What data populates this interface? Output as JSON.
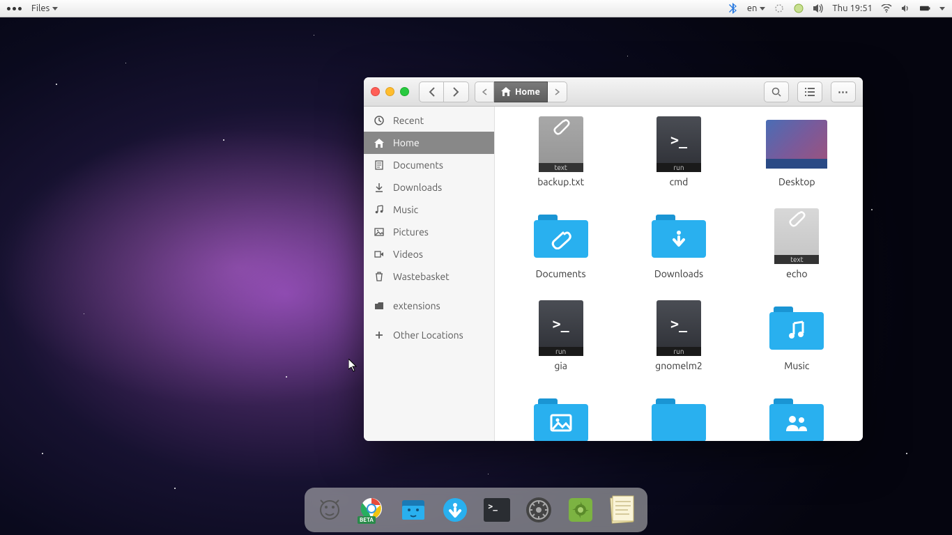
{
  "panel": {
    "app_name": "Files",
    "lang": "en",
    "clock": "Thu 19:51"
  },
  "window": {
    "path_label": "Home"
  },
  "sidebar": {
    "items": [
      {
        "label": "Recent",
        "icon": "clock"
      },
      {
        "label": "Home",
        "icon": "home",
        "active": true
      },
      {
        "label": "Documents",
        "icon": "doc"
      },
      {
        "label": "Downloads",
        "icon": "down"
      },
      {
        "label": "Music",
        "icon": "music"
      },
      {
        "label": "Pictures",
        "icon": "pic"
      },
      {
        "label": "Videos",
        "icon": "vid"
      },
      {
        "label": "Wastebasket",
        "icon": "trash"
      }
    ],
    "extra": {
      "label": "extensions"
    },
    "other": {
      "label": "Other Locations"
    }
  },
  "files": [
    {
      "label": "backup.txt",
      "type": "text",
      "band": "text"
    },
    {
      "label": "cmd",
      "type": "run",
      "band": "run"
    },
    {
      "label": "Desktop",
      "type": "desktop"
    },
    {
      "label": "Documents",
      "type": "folder",
      "glyph": "clip"
    },
    {
      "label": "Downloads",
      "type": "folder",
      "glyph": "down"
    },
    {
      "label": "echo",
      "type": "text-light",
      "band": "text"
    },
    {
      "label": "gia",
      "type": "run",
      "band": "run"
    },
    {
      "label": "gnomelm2",
      "type": "run",
      "band": "run"
    },
    {
      "label": "Music",
      "type": "folder",
      "glyph": "music"
    },
    {
      "label": "",
      "type": "folder",
      "glyph": "pic"
    },
    {
      "label": "",
      "type": "folder",
      "glyph": "blank"
    },
    {
      "label": "",
      "type": "folder",
      "glyph": "people"
    }
  ],
  "dock": {
    "items": [
      {
        "name": "app-launcher",
        "bg": "#e8e8e8"
      },
      {
        "name": "chrome-beta",
        "bg": "#ffffff"
      },
      {
        "name": "files",
        "bg": "#2aa7e8"
      },
      {
        "name": "software",
        "bg": "#2aa7e8"
      },
      {
        "name": "terminal",
        "bg": "#3a3d42"
      },
      {
        "name": "settings",
        "bg": "#555"
      },
      {
        "name": "tweaks",
        "bg": "#7cb342"
      },
      {
        "name": "notes",
        "bg": "#f0e6a0"
      }
    ]
  }
}
